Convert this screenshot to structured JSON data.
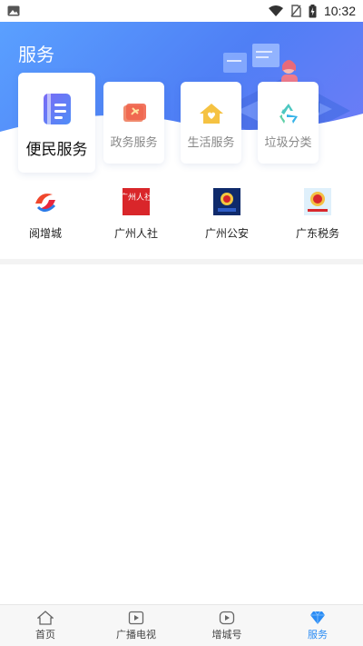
{
  "status_bar": {
    "time": "10:32",
    "icons": [
      "image-icon",
      "wifi-icon",
      "no-sim-icon",
      "battery-charging-icon"
    ]
  },
  "hero": {
    "title": "服务"
  },
  "categories": [
    {
      "label": "便民服务",
      "icon": "document-icon",
      "selected": true
    },
    {
      "label": "政务服务",
      "icon": "party-flag-icon",
      "selected": false
    },
    {
      "label": "生活服务",
      "icon": "house-heart-icon",
      "selected": false
    },
    {
      "label": "垃圾分类",
      "icon": "recycle-icon",
      "selected": false
    }
  ],
  "apps": [
    {
      "name": "阅增城",
      "icon": "yuezengcheng-logo-icon"
    },
    {
      "name": "广州人社",
      "icon": "guangzhou-renshe-logo-icon",
      "logo_text": "广州人社"
    },
    {
      "name": "广州公安",
      "icon": "guangzhou-police-logo-icon"
    },
    {
      "name": "广东税务",
      "icon": "guangdong-tax-logo-icon"
    }
  ],
  "bottom_nav": [
    {
      "label": "首页",
      "icon": "home-icon",
      "active": false
    },
    {
      "label": "广播电视",
      "icon": "tv-play-icon",
      "active": false
    },
    {
      "label": "增城号",
      "icon": "play-badge-icon",
      "active": false
    },
    {
      "label": "服务",
      "icon": "diamond-icon",
      "active": true
    }
  ],
  "colors": {
    "accent": "#2b8cf4",
    "hero_start": "#5aa0ff",
    "hero_end": "#6e7cf7"
  }
}
